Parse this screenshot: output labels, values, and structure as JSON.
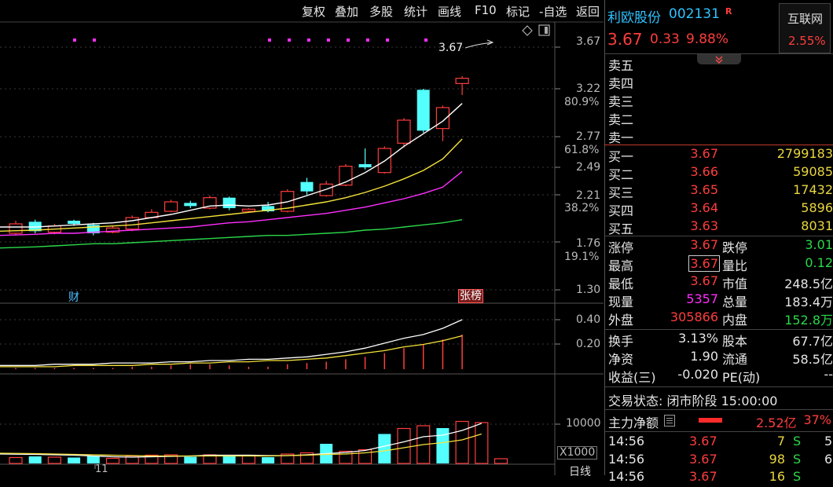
{
  "toolbar": {
    "items": [
      "复权",
      "叠加",
      "多股",
      "统计",
      "画线",
      "F10",
      "标记",
      "-自选",
      "返回"
    ]
  },
  "chart": {
    "price_ticks": [
      "3.67",
      "3.22",
      "2.77",
      "2.49",
      "2.21",
      "1.76",
      "1.30"
    ],
    "pct_ticks": [
      "80.9%",
      "61.8%",
      "38.2%",
      "19.1%"
    ],
    "high_label": "3.67",
    "finance_marker": "财",
    "zhangbang_marker": "张榜",
    "vol_ticks": [
      "0.40",
      "0.20"
    ],
    "volume_tick": "10000",
    "volume_unit": "X1000",
    "period_label": "日线",
    "date_label": "11"
  },
  "chart_data": {
    "type": "candlestick",
    "candles": [
      {
        "o": 1.84,
        "c": 1.93,
        "h": 1.96,
        "l": 1.82
      },
      {
        "o": 1.95,
        "c": 1.86,
        "h": 1.97,
        "l": 1.84
      },
      {
        "o": 1.85,
        "c": 1.91,
        "h": 1.93,
        "l": 1.83
      },
      {
        "o": 1.96,
        "c": 1.93,
        "h": 1.97,
        "l": 1.91
      },
      {
        "o": 1.92,
        "c": 1.84,
        "h": 1.94,
        "l": 1.82
      },
      {
        "o": 1.85,
        "c": 1.89,
        "h": 1.91,
        "l": 1.84
      },
      {
        "o": 1.88,
        "c": 1.99,
        "h": 2.01,
        "l": 1.86
      },
      {
        "o": 1.99,
        "c": 2.04,
        "h": 2.07,
        "l": 1.98
      },
      {
        "o": 2.05,
        "c": 2.14,
        "h": 2.16,
        "l": 2.04
      },
      {
        "o": 2.13,
        "c": 2.1,
        "h": 2.15,
        "l": 2.08
      },
      {
        "o": 2.08,
        "c": 2.18,
        "h": 2.2,
        "l": 2.07
      },
      {
        "o": 2.18,
        "c": 2.08,
        "h": 2.19,
        "l": 2.06
      },
      {
        "o": 2.05,
        "c": 2.07,
        "h": 2.08,
        "l": 2.04
      },
      {
        "o": 2.1,
        "c": 2.05,
        "h": 2.14,
        "l": 2.04
      },
      {
        "o": 2.05,
        "c": 2.24,
        "h": 2.26,
        "l": 2.04
      },
      {
        "o": 2.33,
        "c": 2.24,
        "h": 2.37,
        "l": 2.21
      },
      {
        "o": 2.2,
        "c": 2.31,
        "h": 2.34,
        "l": 2.19
      },
      {
        "o": 2.3,
        "c": 2.48,
        "h": 2.5,
        "l": 2.29
      },
      {
        "o": 2.5,
        "c": 2.47,
        "h": 2.65,
        "l": 2.45
      },
      {
        "o": 2.42,
        "c": 2.65,
        "h": 2.67,
        "l": 2.41
      },
      {
        "o": 2.7,
        "c": 2.92,
        "h": 2.94,
        "l": 2.66
      },
      {
        "o": 3.21,
        "c": 2.82,
        "h": 3.22,
        "l": 2.8
      },
      {
        "o": 2.84,
        "c": 3.04,
        "h": 3.06,
        "l": 2.72
      },
      {
        "o": 3.27,
        "c": 3.32,
        "h": 3.34,
        "l": 3.16
      }
    ],
    "ma5": [
      1.9,
      1.9,
      1.91,
      1.92,
      1.93,
      1.94,
      1.96,
      1.99,
      2.02,
      2.06,
      2.1,
      2.11,
      2.1,
      2.11,
      2.14,
      2.2,
      2.26,
      2.33,
      2.42,
      2.53,
      2.67,
      2.79,
      2.91,
      3.08
    ],
    "ma10": [
      1.86,
      1.87,
      1.88,
      1.89,
      1.9,
      1.91,
      1.92,
      1.94,
      1.96,
      1.98,
      2.0,
      2.02,
      2.04,
      2.06,
      2.08,
      2.11,
      2.14,
      2.18,
      2.23,
      2.29,
      2.36,
      2.44,
      2.55,
      2.74
    ],
    "ma20": [
      1.82,
      1.83,
      1.84,
      1.84,
      1.85,
      1.86,
      1.87,
      1.88,
      1.89,
      1.9,
      1.92,
      1.94,
      1.95,
      1.97,
      1.99,
      2.01,
      2.03,
      2.06,
      2.09,
      2.13,
      2.17,
      2.22,
      2.28,
      2.43
    ],
    "ma60": [
      1.7,
      1.71,
      1.72,
      1.73,
      1.74,
      1.74,
      1.75,
      1.76,
      1.77,
      1.78,
      1.79,
      1.8,
      1.81,
      1.82,
      1.82,
      1.83,
      1.84,
      1.85,
      1.87,
      1.88,
      1.9,
      1.92,
      1.94,
      1.97
    ],
    "indicator": {
      "bars": [
        0.01,
        0.01,
        0.01,
        0.01,
        0.01,
        0.01,
        0.02,
        0.02,
        0.03,
        0.04,
        0.04,
        0.03,
        0.02,
        0.02,
        0.04,
        0.05,
        0.06,
        0.08,
        0.1,
        0.13,
        0.17,
        0.2,
        0.24,
        0.28
      ],
      "line1": [
        0.03,
        0.03,
        0.04,
        0.04,
        0.04,
        0.05,
        0.05,
        0.05,
        0.06,
        0.06,
        0.07,
        0.07,
        0.08,
        0.08,
        0.09,
        0.1,
        0.12,
        0.14,
        0.17,
        0.21,
        0.25,
        0.28,
        0.33,
        0.4
      ],
      "line2": [
        0.02,
        0.02,
        0.02,
        0.03,
        0.03,
        0.03,
        0.03,
        0.04,
        0.04,
        0.05,
        0.05,
        0.06,
        0.06,
        0.07,
        0.07,
        0.08,
        0.09,
        0.11,
        0.13,
        0.15,
        0.18,
        0.2,
        0.23,
        0.27
      ]
    },
    "volume": {
      "values": [
        1500,
        1800,
        1600,
        1500,
        1900,
        1300,
        1900,
        2100,
        2200,
        1700,
        2200,
        2000,
        2100,
        1600,
        2400,
        2700,
        5000,
        3100,
        3500,
        7500,
        8900,
        9600,
        9000,
        10700,
        10400,
        1200
      ],
      "ma5": [
        2400,
        2300,
        2200,
        2100,
        1900,
        1700,
        1600,
        1700,
        1800,
        1900,
        2100,
        2100,
        2100,
        2000,
        2000,
        2200,
        2500,
        2800,
        3300,
        4400,
        5500,
        6800,
        7200,
        8400,
        10200,
        9400
      ],
      "ma10": [
        2600,
        2500,
        2400,
        2300,
        2200,
        2100,
        2000,
        1900,
        1900,
        1900,
        1900,
        1900,
        1900,
        1900,
        2000,
        2100,
        2300,
        2400,
        2700,
        3200,
        4000,
        4800,
        5300,
        6000,
        7500,
        7600
      ]
    }
  },
  "quote": {
    "name": "利欧股份",
    "code": "002131",
    "r_badge": "R",
    "price": "3.67",
    "change": "0.33",
    "change_pct": "9.88%",
    "sector": "互联网",
    "sector_pct": "2.55%"
  },
  "orderbook": {
    "sell": [
      {
        "label": "卖五",
        "price": "",
        "vol": ""
      },
      {
        "label": "卖四",
        "price": "",
        "vol": ""
      },
      {
        "label": "卖三",
        "price": "",
        "vol": ""
      },
      {
        "label": "卖二",
        "price": "",
        "vol": ""
      },
      {
        "label": "卖一",
        "price": "",
        "vol": ""
      }
    ],
    "buy": [
      {
        "label": "买一",
        "price": "3.67",
        "vol": "2799183"
      },
      {
        "label": "买二",
        "price": "3.66",
        "vol": "59085"
      },
      {
        "label": "买三",
        "price": "3.65",
        "vol": "17432"
      },
      {
        "label": "买四",
        "price": "3.64",
        "vol": "5896"
      },
      {
        "label": "买五",
        "price": "3.63",
        "vol": "8031"
      }
    ]
  },
  "stats": [
    {
      "l1": "涨停",
      "v1": "3.67",
      "l2": "跌停",
      "v2": "3.01"
    },
    {
      "l1": "最高",
      "v1": "3.67",
      "l2": "量比",
      "v2": "0.12"
    },
    {
      "l1": "最低",
      "v1": "3.67",
      "l2": "市值",
      "v2": "248.5亿"
    },
    {
      "l1": "现量",
      "v1": "5357",
      "l2": "总量",
      "v2": "183.4万"
    },
    {
      "l1": "外盘",
      "v1": "305866",
      "l2": "内盘",
      "v2": "152.8万"
    }
  ],
  "stats2": [
    {
      "l1": "换手",
      "v1": "3.13%",
      "l2": "股本",
      "v2": "67.7亿"
    },
    {
      "l1": "净资",
      "v1": "1.90",
      "l2": "流通",
      "v2": "58.5亿"
    },
    {
      "l1": "收益(三)",
      "v1": "-0.020",
      "l2": "PE(动)",
      "v2": "--"
    }
  ],
  "trade_status": "交易状态: 闭市阶段 15:00:00",
  "main_flow": {
    "label": "主力净额",
    "amount": "2.52亿",
    "pct": "37%"
  },
  "ticks": [
    {
      "time": "14:56",
      "price": "3.67",
      "vol": "7",
      "side": "S",
      "extra": "5"
    },
    {
      "time": "14:56",
      "price": "3.67",
      "vol": "98",
      "side": "S",
      "extra": "6"
    },
    {
      "time": "14:56",
      "price": "3.67",
      "vol": "16",
      "side": "S",
      "extra": ""
    }
  ]
}
